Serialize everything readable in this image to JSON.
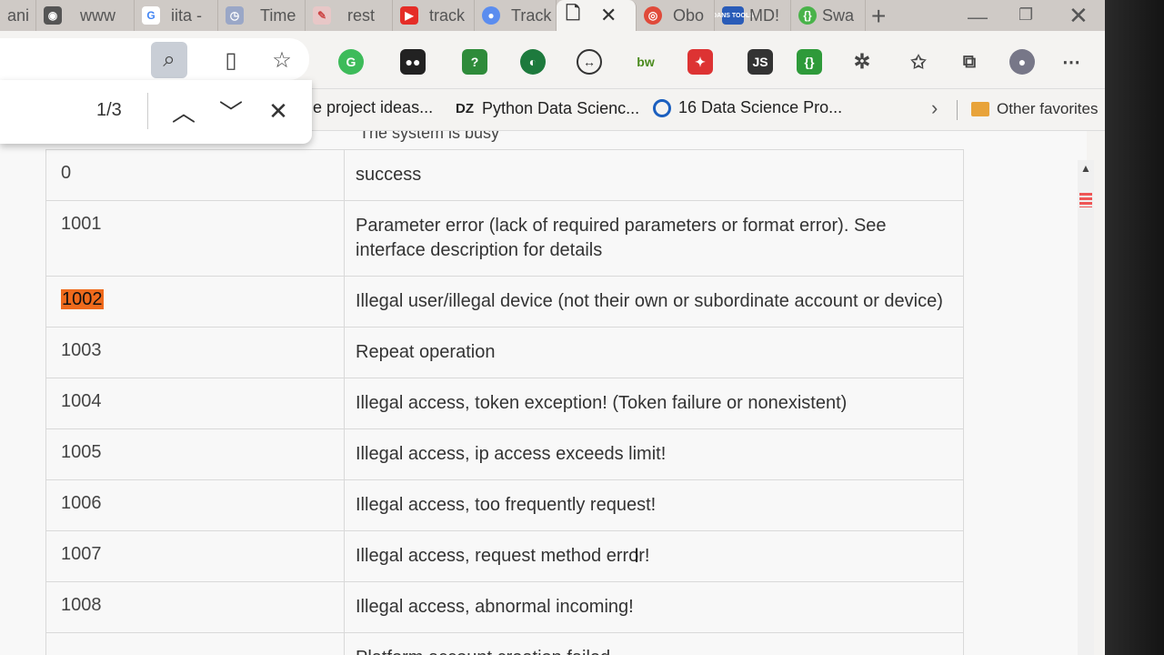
{
  "tabs": [
    {
      "label": "ani",
      "icon": "partial-icon",
      "color": "#888888"
    },
    {
      "label": "www",
      "icon": "browser-icon",
      "color": "#555555"
    },
    {
      "label": "iita -",
      "icon": "google-icon",
      "color": "#4285f4"
    },
    {
      "label": "Time",
      "icon": "timer-icon",
      "color": "#9aa7c7"
    },
    {
      "label": "rest",
      "icon": "rest-icon",
      "color": "#d66"
    },
    {
      "label": "track",
      "icon": "youtube-icon",
      "color": "#e52d27"
    },
    {
      "label": "Track",
      "icon": "chat-icon",
      "color": "#5b8def"
    },
    {
      "label": "",
      "icon": "page-icon",
      "color": "#333333",
      "active": true
    },
    {
      "label": "Obo",
      "icon": "chrome-icon",
      "color": "#e04a3a"
    },
    {
      "label": "MD!",
      "icon": "dans-tools-icon",
      "color": "#2a5cb8",
      "badge": "DANS TOOLS"
    },
    {
      "label": "Swa",
      "icon": "swagger-icon",
      "color": "#49b34a"
    }
  ],
  "find": {
    "count": "1/3"
  },
  "bookmarks": [
    {
      "label": "e project ideas...",
      "icon": ""
    },
    {
      "label": "Python Data Scienc...",
      "icon": "DZ"
    },
    {
      "label": "16 Data Science Pro...",
      "icon": "circle-d-icon"
    }
  ],
  "other_favorites": "Other favorites",
  "cut_text": "The system is busy",
  "rows": [
    {
      "code": "0",
      "desc": "success"
    },
    {
      "code": "1001",
      "desc": "Parameter error (lack of required parameters or format error). See interface description for details"
    },
    {
      "code": "1002",
      "desc": "Illegal user/illegal device (not their own or subordinate account or device)",
      "highlight": true
    },
    {
      "code": "1003",
      "desc": "Repeat operation"
    },
    {
      "code": "1004",
      "desc": "Illegal access, token exception! (Token failure or nonexistent)"
    },
    {
      "code": "1005",
      "desc": "Illegal access, ip access exceeds limit!"
    },
    {
      "code": "1006",
      "desc": "Illegal access, too frequently request!"
    },
    {
      "code": "1007",
      "desc": "Illegal access, request method error!"
    },
    {
      "code": "1008",
      "desc": "Illegal access, abnormal incoming!"
    },
    {
      "code": "",
      "desc": "Platform account creation failed"
    }
  ],
  "colors": {
    "highlight": "#ef6a1c",
    "accent": "#c9ced6"
  }
}
